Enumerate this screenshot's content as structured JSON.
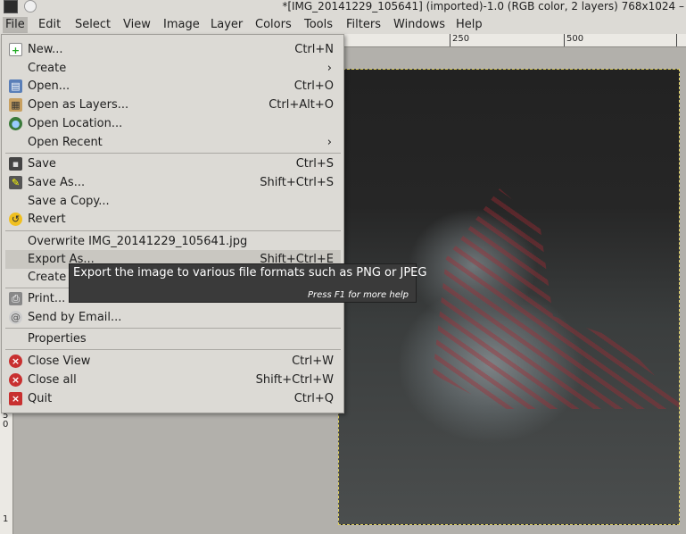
{
  "window": {
    "title": "*[IMG_20141229_105641] (imported)-1.0 (RGB color, 2 layers) 768x1024 –"
  },
  "menubar": {
    "items": [
      "File",
      "Edit",
      "Select",
      "View",
      "Image",
      "Layer",
      "Colors",
      "Tools",
      "Filters",
      "Windows",
      "Help"
    ]
  },
  "ruler": {
    "top_labels": [
      "250",
      "500"
    ],
    "left_labels": [
      "5",
      "0",
      "1"
    ]
  },
  "file_menu": {
    "items": [
      {
        "label": "New...",
        "shortcut": "Ctrl+N",
        "icon": "new-icon"
      },
      {
        "label": "Create",
        "submenu": true
      },
      {
        "label": "Open...",
        "shortcut": "Ctrl+O",
        "icon": "open-icon"
      },
      {
        "label": "Open as Layers...",
        "shortcut": "Ctrl+Alt+O",
        "icon": "open-layers-icon"
      },
      {
        "label": "Open Location...",
        "icon": "location-icon"
      },
      {
        "label": "Open Recent",
        "submenu": true
      },
      {
        "label": "Save",
        "shortcut": "Ctrl+S",
        "icon": "save-icon"
      },
      {
        "label": "Save As...",
        "shortcut": "Shift+Ctrl+S",
        "icon": "save-as-icon"
      },
      {
        "label": "Save a Copy..."
      },
      {
        "label": "Revert",
        "icon": "revert-icon"
      },
      {
        "label": "Overwrite IMG_20141229_105641.jpg"
      },
      {
        "label": "Export As...",
        "shortcut": "Shift+Ctrl+E",
        "highlighted": true
      },
      {
        "label": "Create"
      },
      {
        "label": "Print...",
        "icon": "print-icon"
      },
      {
        "label": "Send by Email...",
        "icon": "email-icon"
      },
      {
        "label": "Properties"
      },
      {
        "label": "Close View",
        "shortcut": "Ctrl+W",
        "icon": "close-view-icon"
      },
      {
        "label": "Close all",
        "shortcut": "Shift+Ctrl+W",
        "icon": "close-all-icon"
      },
      {
        "label": "Quit",
        "shortcut": "Ctrl+Q",
        "icon": "quit-icon"
      }
    ]
  },
  "tooltip": {
    "text": "Export the image to various file formats such as PNG or JPEG",
    "help": "Press F1 for more help"
  },
  "partial_text": "C"
}
